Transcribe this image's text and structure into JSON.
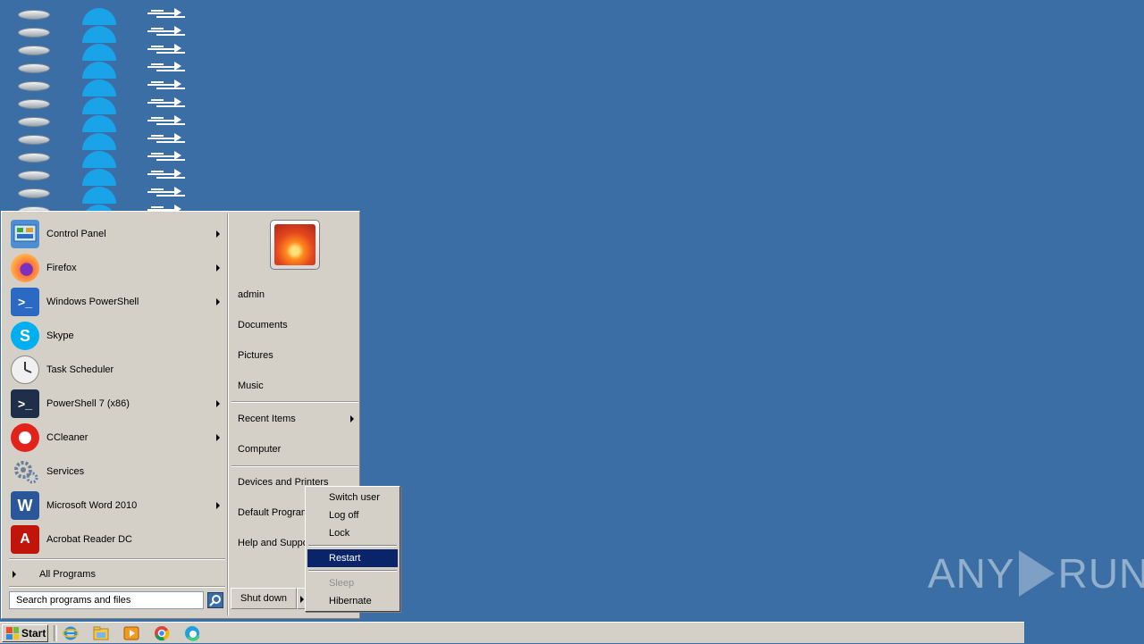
{
  "desktop": {
    "icon_rows": 12,
    "icon_columns": [
      "disk-icon",
      "edge-arc-icon",
      "document-icon"
    ]
  },
  "start_menu": {
    "programs": [
      {
        "label": "Control Panel",
        "icon": "control-panel-icon",
        "submenu": true
      },
      {
        "label": "Firefox",
        "icon": "firefox-icon",
        "submenu": true
      },
      {
        "label": "Windows PowerShell",
        "icon": "powershell-icon",
        "submenu": true
      },
      {
        "label": "Skype",
        "icon": "skype-icon",
        "submenu": false
      },
      {
        "label": "Task Scheduler",
        "icon": "task-scheduler-icon",
        "submenu": false
      },
      {
        "label": "PowerShell 7 (x86)",
        "icon": "powershell7-icon",
        "submenu": true
      },
      {
        "label": "CCleaner",
        "icon": "ccleaner-icon",
        "submenu": true
      },
      {
        "label": "Services",
        "icon": "services-icon",
        "submenu": false
      },
      {
        "label": "Microsoft Word 2010",
        "icon": "word-icon",
        "submenu": true
      },
      {
        "label": "Acrobat Reader DC",
        "icon": "acrobat-icon",
        "submenu": false
      }
    ],
    "all_programs": "All Programs",
    "search_placeholder": "Search programs and files",
    "right_links": [
      {
        "label": "admin"
      },
      {
        "label": "Documents"
      },
      {
        "label": "Pictures"
      },
      {
        "label": "Music"
      },
      {
        "label": "Recent Items",
        "submenu": true
      },
      {
        "label": "Computer"
      },
      {
        "label": "Devices and Printers"
      },
      {
        "label": "Default Programs"
      },
      {
        "label": "Help and Support"
      }
    ],
    "shutdown_label": "Shut down"
  },
  "shutdown_submenu": {
    "items": [
      {
        "label": "Switch user",
        "state": "normal"
      },
      {
        "label": "Log off",
        "state": "normal"
      },
      {
        "label": "Lock",
        "state": "normal"
      },
      {
        "label": "Restart",
        "state": "highlighted"
      },
      {
        "label": "Sleep",
        "state": "disabled"
      },
      {
        "label": "Hibernate",
        "state": "normal"
      }
    ]
  },
  "taskbar": {
    "start_label": "Start",
    "pinned": [
      "internet-explorer-icon",
      "file-explorer-icon",
      "media-player-icon",
      "chrome-icon",
      "edge-icon"
    ]
  },
  "watermark": {
    "left": "ANY",
    "right": "RUN"
  },
  "colors": {
    "desktop": "#3a6ea5",
    "highlight": "#0a246a",
    "chrome_gray": "#d4d0c8"
  }
}
